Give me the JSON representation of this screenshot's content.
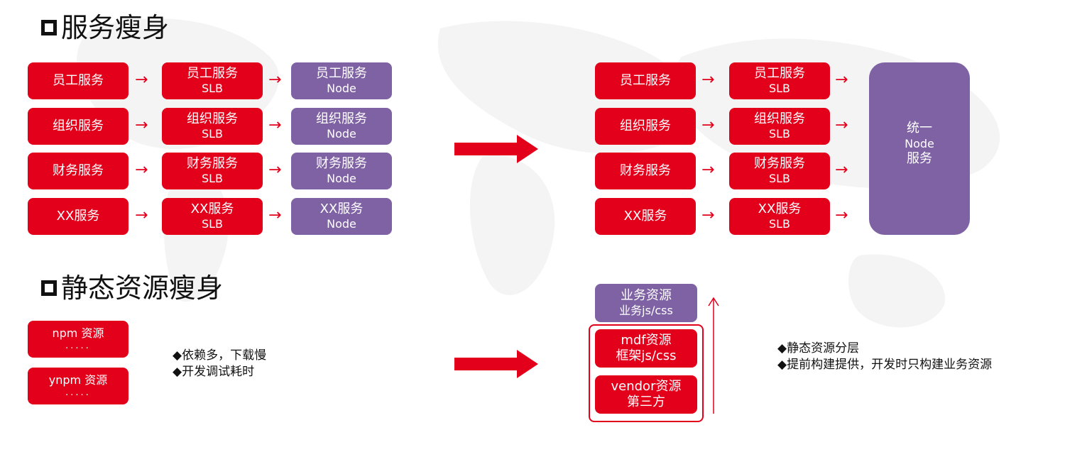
{
  "section1": {
    "title": "服务瘦身",
    "before": [
      {
        "service": "员工服务",
        "slb_line1": "员工服务",
        "slb_line2": "SLB",
        "node_line1": "员工服务",
        "node_line2": "Node"
      },
      {
        "service": "组织服务",
        "slb_line1": "组织服务",
        "slb_line2": "SLB",
        "node_line1": "组织服务",
        "node_line2": "Node"
      },
      {
        "service": "财务服务",
        "slb_line1": "财务服务",
        "slb_line2": "SLB",
        "node_line1": "财务服务",
        "node_line2": "Node"
      },
      {
        "service": "XX服务",
        "slb_line1": "XX服务",
        "slb_line2": "SLB",
        "node_line1": "XX服务",
        "node_line2": "Node"
      }
    ],
    "after": [
      {
        "service": "员工服务",
        "slb_line1": "员工服务",
        "slb_line2": "SLB"
      },
      {
        "service": "组织服务",
        "slb_line1": "组织服务",
        "slb_line2": "SLB"
      },
      {
        "service": "财务服务",
        "slb_line1": "财务服务",
        "slb_line2": "SLB"
      },
      {
        "service": "XX服务",
        "slb_line1": "XX服务",
        "slb_line2": "SLB"
      }
    ],
    "unified": {
      "line1": "统一",
      "line2": "Node",
      "line3": "服务"
    }
  },
  "section2": {
    "title": "静态资源瘦身",
    "before": [
      {
        "line1": "npm 资源",
        "line2": "....."
      },
      {
        "line1": "ynpm 资源",
        "line2": "....."
      }
    ],
    "before_bullets": [
      "依赖多，下载慢",
      "开发调试耗时"
    ],
    "after_top": {
      "line1": "业务资源",
      "line2": "业务js/css"
    },
    "after_group": [
      {
        "line1": "mdf资源",
        "line2": "框架js/css"
      },
      {
        "line1": "vendor资源",
        "line2": "第三方"
      }
    ],
    "after_bullets": [
      "静态资源分层",
      "提前构建提供，开发时只构建业务资源"
    ]
  },
  "glyphs": {
    "arrow": "→",
    "bullet": "◆"
  },
  "colors": {
    "red": "#e3001b",
    "purple": "#7f62a4"
  }
}
